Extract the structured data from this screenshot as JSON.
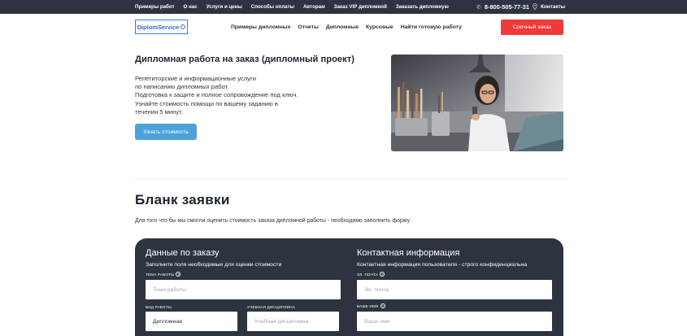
{
  "topbar": {
    "links": [
      "Примеры работ",
      "О нас",
      "Услуги и цены",
      "Способы оплаты",
      "Авторам",
      "Заказ VIP дипломной",
      "Заказать дипломную"
    ],
    "phone": "8-800-505-77-31",
    "contacts": "Контакты",
    "background": "#2d3340"
  },
  "header": {
    "logo_text": "DiplomService",
    "nav": [
      "Примеры дипломных",
      "Отчеты",
      "Дипломные",
      "Курсовые",
      "Найти готовую работу"
    ],
    "urgent_label": "Срочный заказ",
    "urgent_color": "#f03a3a"
  },
  "hero": {
    "title": "Дипломная работа на заказ (дипломный проект)",
    "description": [
      "Репетиторские и информационные услуги",
      "по написанию дипломных работ.",
      "Подготовка к защите и полное сопровождение под ключ.",
      "Узнайте стоимость помощи по вашему заданию в",
      "течении 5 минут."
    ],
    "cta_label": "Узнать стоимость",
    "cta_color": "#4aa3d8"
  },
  "form": {
    "title": "Бланк заявки",
    "subtitle": "Для того что бы мы смогли оценить стоимость заказа дипломной работы - необходимо заполнить форму",
    "order": {
      "title": "Данные по заказу",
      "subtitle": "Заполните поля необходимые для оценки стоимости",
      "topic_label": "Тема работы",
      "topic_placeholder": "Тема работы",
      "type_label": "Вид работы",
      "type_value": "Дипломная",
      "discipline_label": "Учебная дисциплина",
      "discipline_placeholder": "Учебная дисциплина"
    },
    "contact": {
      "title": "Контактная информация",
      "subtitle": "Контактная информация пользователя - строго конфиденциальна",
      "email_label": "Эл. почта",
      "email_placeholder": "Эл. почта",
      "name_label": "Ваше имя",
      "name_placeholder": "Ваше имя"
    },
    "panel_color": "#2d3440"
  }
}
